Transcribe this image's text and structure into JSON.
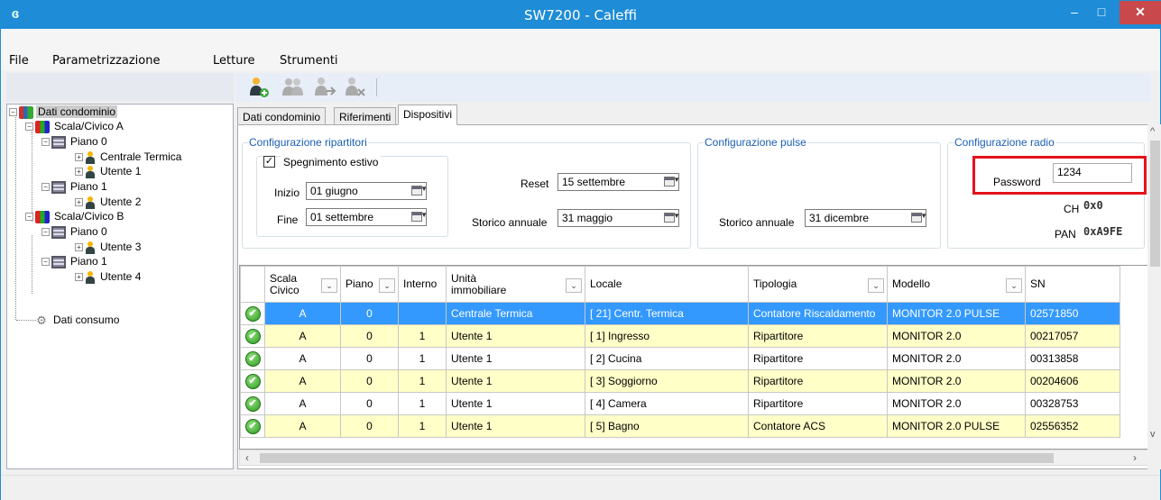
{
  "window": {
    "title": "SW7200 - Caleffi",
    "min_glyph": "–",
    "max_glyph": "□",
    "close_glyph": "✕",
    "app_icon": "ɞ"
  },
  "menu": [
    {
      "label": "File"
    },
    {
      "label": "Parametrizzazione"
    },
    {
      "label": "Letture"
    },
    {
      "label": "Strumenti"
    }
  ],
  "toolbar": {
    "icons": [
      "add-user-icon",
      "users-icon",
      "user-move-icon",
      "remove-user-icon"
    ]
  },
  "tree": {
    "root": "Dati condominio",
    "scala_a": "Scala/Civico A",
    "piano_a0": "Piano  0",
    "centrale": "Centrale Termica",
    "utente1": "Utente 1",
    "piano_a1": "Piano  1",
    "utente2": "Utente 2",
    "scala_b": "Scala/Civico B",
    "piano_b0": "Piano  0",
    "utente3": "Utente 3",
    "piano_b1": "Piano  1",
    "utente4": "Utente 4",
    "consumo": "Dati consumo"
  },
  "tabs": {
    "dati": "Dati condominio",
    "riferimenti": "Riferimenti",
    "dispositivi": "Dispositivi",
    "active": "Dispositivi"
  },
  "ripartitori": {
    "legend": "Configurazione ripartitori",
    "spegnimento_label": "Spegnimento estivo",
    "spegnimento_checked": true,
    "inizio_label": "Inizio",
    "inizio_value": "01  giugno",
    "fine_label": "Fine",
    "fine_value": "01 settembre",
    "reset_label": "Reset",
    "reset_value": "15 settembre",
    "storico_label": "Storico annuale",
    "storico_value": "31  maggio"
  },
  "pulse": {
    "legend": "Configurazione pulse",
    "storico_label": "Storico annuale",
    "storico_value": "31 dicembre"
  },
  "radio": {
    "legend": "Configurazione radio",
    "password_label": "Password",
    "password_value": "1234",
    "ch_label": "CH",
    "ch_value": "0x0",
    "pan_label": "PAN",
    "pan_value": "0xA9FE"
  },
  "grid": {
    "columns": [
      {
        "label": "Scala\nCivico",
        "dropdown": true
      },
      {
        "label": "Piano",
        "dropdown": true
      },
      {
        "label": "Interno",
        "dropdown": false
      },
      {
        "label": "Unità\nimmobiliare",
        "dropdown": true
      },
      {
        "label": "Locale",
        "dropdown": false
      },
      {
        "label": "Tipologia",
        "dropdown": true
      },
      {
        "label": "Modello",
        "dropdown": true
      },
      {
        "label": "SN",
        "dropdown": false
      }
    ],
    "rows": [
      {
        "scala": "A",
        "piano": "0",
        "interno": "",
        "unita": "Centrale Termica",
        "locale": "[ 21] Centr. Termica",
        "tipologia": "Contatore Riscaldamento",
        "modello": "MONITOR 2.0 PULSE",
        "sn": "02571850",
        "style": "sel"
      },
      {
        "scala": "A",
        "piano": "0",
        "interno": "1",
        "unita": "Utente 1",
        "locale": "[  1] Ingresso",
        "tipologia": "Ripartitore",
        "modello": "MONITOR 2.0",
        "sn": "00217057",
        "style": "alt"
      },
      {
        "scala": "A",
        "piano": "0",
        "interno": "1",
        "unita": "Utente 1",
        "locale": "[  2] Cucina",
        "tipologia": "Ripartitore",
        "modello": "MONITOR 2.0",
        "sn": "00313858",
        "style": ""
      },
      {
        "scala": "A",
        "piano": "0",
        "interno": "1",
        "unita": "Utente 1",
        "locale": "[  3] Soggiorno",
        "tipologia": "Ripartitore",
        "modello": "MONITOR 2.0",
        "sn": "00204606",
        "style": "alt"
      },
      {
        "scala": "A",
        "piano": "0",
        "interno": "1",
        "unita": "Utente 1",
        "locale": "[  4] Camera",
        "tipologia": "Ripartitore",
        "modello": "MONITOR 2.0",
        "sn": "00328753",
        "style": ""
      },
      {
        "scala": "A",
        "piano": "0",
        "interno": "1",
        "unita": "Utente 1",
        "locale": "[  5] Bagno",
        "tipologia": "Contatore ACS",
        "modello": "MONITOR 2.0 PULSE",
        "sn": "02556352",
        "style": "alt"
      }
    ],
    "status_icon": "check-circle-icon",
    "status_glyph": "✔"
  },
  "colors": {
    "titlebar": "#1e8cd6",
    "selection": "#3399ff",
    "alt_row": "#ffffc8",
    "legend": "#1a5fb4",
    "highlight_box": "#e5121a"
  }
}
